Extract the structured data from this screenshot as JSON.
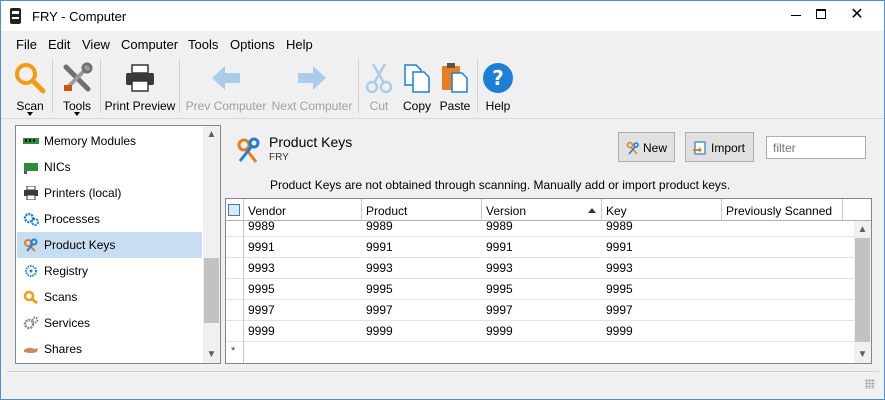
{
  "window": {
    "title": "FRY - Computer"
  },
  "menu": [
    "File",
    "Edit",
    "View",
    "Computer",
    "Tools",
    "Options",
    "Help"
  ],
  "toolbar": {
    "scan": "Scan",
    "tools": "Tools",
    "print_preview": "Print Preview",
    "prev_computer": "Prev Computer",
    "next_computer": "Next Computer",
    "cut": "Cut",
    "copy": "Copy",
    "paste": "Paste",
    "help": "Help"
  },
  "nav": {
    "items": [
      {
        "label": "Memory Modules",
        "icon": "memory-icon"
      },
      {
        "label": "NICs",
        "icon": "nic-icon"
      },
      {
        "label": "Printers (local)",
        "icon": "printer-icon"
      },
      {
        "label": "Processes",
        "icon": "gears-icon"
      },
      {
        "label": "Product Keys",
        "icon": "keys-icon",
        "selected": true
      },
      {
        "label": "Registry",
        "icon": "registry-icon"
      },
      {
        "label": "Scans",
        "icon": "search-icon"
      },
      {
        "label": "Services",
        "icon": "cogs-icon"
      },
      {
        "label": "Shares",
        "icon": "share-icon"
      }
    ]
  },
  "content": {
    "title": "Product Keys",
    "subtitle": "FRY",
    "new_label": "New",
    "import_label": "Import",
    "filter_placeholder": "filter",
    "notice": "Product Keys are not obtained through scanning. Manually add or import product keys."
  },
  "grid": {
    "columns": [
      "Vendor",
      "Product",
      "Version",
      "Key",
      "Previously Scanned"
    ],
    "sorted_column": "Version",
    "rows": [
      [
        "9989",
        "9989",
        "9989",
        "9989",
        ""
      ],
      [
        "9991",
        "9991",
        "9991",
        "9991",
        ""
      ],
      [
        "9993",
        "9993",
        "9993",
        "9993",
        ""
      ],
      [
        "9995",
        "9995",
        "9995",
        "9995",
        ""
      ],
      [
        "9997",
        "9997",
        "9997",
        "9997",
        ""
      ],
      [
        "9999",
        "9999",
        "9999",
        "9999",
        ""
      ]
    ],
    "new_row_marker": "*"
  },
  "colors": {
    "selection": "#c7def2",
    "accent": "#1e7fd6",
    "scan_orange": "#f39c12"
  }
}
